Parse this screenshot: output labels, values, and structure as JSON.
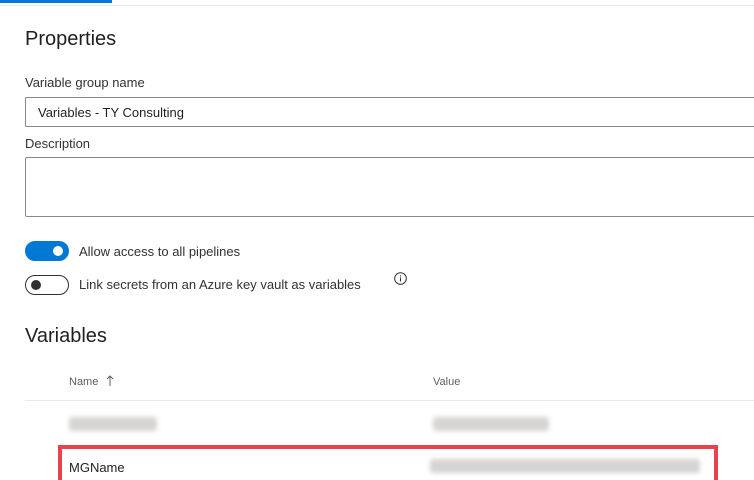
{
  "properties": {
    "title": "Properties",
    "variable_group_name_label": "Variable group name",
    "variable_group_name_value": "Variables - TY Consulting",
    "description_label": "Description",
    "description_value": ""
  },
  "toggles": {
    "allow_access": {
      "label": "Allow access to all pipelines",
      "state": "on"
    },
    "link_secrets": {
      "label": "Link secrets from an Azure key vault as variables",
      "state": "off"
    }
  },
  "variables": {
    "title": "Variables",
    "columns": {
      "name": "Name",
      "value": "Value"
    },
    "rows": [
      {
        "name": "",
        "value": ""
      },
      {
        "name": "MGName",
        "value": ""
      }
    ]
  },
  "icons": {
    "sort": "arrow-up-icon",
    "info": "info-icon"
  },
  "colors": {
    "accent": "#0078d4",
    "highlight_border": "#e8434d"
  }
}
